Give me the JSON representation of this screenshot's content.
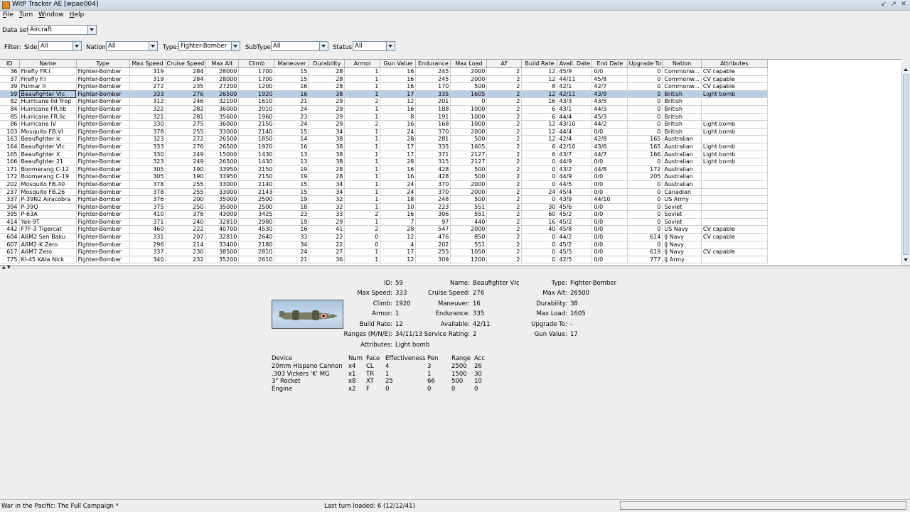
{
  "window": {
    "title": "WitP Tracker AE [wpae004]"
  },
  "menu": [
    {
      "first": "F",
      "rest": "ile"
    },
    {
      "first": "T",
      "rest": "urn"
    },
    {
      "first": "W",
      "rest": "indow"
    },
    {
      "first": "H",
      "rest": "elp"
    }
  ],
  "dataset": {
    "label": "Data set:",
    "value": "Aircraft"
  },
  "filter": {
    "label": "Filter:",
    "side": {
      "label": "Side:",
      "value": "All"
    },
    "nation": {
      "label": "Nation:",
      "value": "All"
    },
    "type": {
      "label": "Type:",
      "value": "Fighter-Bomber"
    },
    "subtype": {
      "label": "SubType:",
      "value": "All"
    },
    "status": {
      "label": "Status:",
      "value": "All"
    }
  },
  "table": {
    "columns": [
      "ID",
      "Name",
      "Type",
      "Max Speed",
      "Cruise Speed",
      "Max Alt",
      "Climb",
      "Maneuver",
      "Durability",
      "Armor",
      "Gun Value",
      "Endurance",
      "Max Load",
      "AF",
      "Build Rate",
      "Avail. Date",
      "End Date",
      "Upgrade To",
      "Nation",
      "Attributes"
    ],
    "selected_index": 3,
    "rows": [
      [
        "36",
        "Firefly FR.I",
        "Fighter-Bomber",
        "319",
        "284",
        "28000",
        "1700",
        "15",
        "28",
        "1",
        "16",
        "245",
        "2000",
        "2",
        "12",
        "45/9",
        "0/0",
        "0",
        "Commonw...",
        "CV capable"
      ],
      [
        "37",
        "Firefly F.I",
        "Fighter-Bomber",
        "319",
        "284",
        "28000",
        "1700",
        "15",
        "28",
        "1",
        "16",
        "245",
        "2000",
        "2",
        "12",
        "44/11",
        "45/8",
        "0",
        "Commonw...",
        "CV capable"
      ],
      [
        "39",
        "Fulmar II",
        "Fighter-Bomber",
        "272",
        "235",
        "27200",
        "1200",
        "16",
        "28",
        "1",
        "16",
        "170",
        "500",
        "2",
        "8",
        "42/1",
        "42/7",
        "0",
        "Commonw...",
        "CV capable"
      ],
      [
        "59",
        "Beaufighter VIc",
        "Fighter-Bomber",
        "333",
        "276",
        "26500",
        "1920",
        "16",
        "38",
        "1",
        "17",
        "335",
        "1605",
        "2",
        "12",
        "42/11",
        "43/9",
        "0",
        "British",
        "Light bomb"
      ],
      [
        "82",
        "Hurricane IId Trop",
        "Fighter-Bomber",
        "312",
        "246",
        "32100",
        "1610",
        "21",
        "29",
        "2",
        "12",
        "201",
        "0",
        "2",
        "16",
        "43/3",
        "43/5",
        "0",
        "British",
        ""
      ],
      [
        "84",
        "Hurricane FR.IIb",
        "Fighter-Bomber",
        "322",
        "282",
        "36000",
        "2010",
        "24",
        "29",
        "1",
        "16",
        "188",
        "1000",
        "2",
        "6",
        "43/1",
        "44/3",
        "0",
        "British",
        ""
      ],
      [
        "85",
        "Hurricane FR.IIc",
        "Fighter-Bomber",
        "321",
        "281",
        "35600",
        "1960",
        "23",
        "29",
        "1",
        "8",
        "191",
        "1000",
        "2",
        "6",
        "44/4",
        "45/3",
        "0",
        "British",
        ""
      ],
      [
        "86",
        "Hurricane IV",
        "Fighter-Bomber",
        "330",
        "275",
        "36000",
        "2150",
        "24",
        "29",
        "2",
        "16",
        "168",
        "1000",
        "2",
        "12",
        "43/10",
        "44/2",
        "0",
        "British",
        "Light bomb"
      ],
      [
        "103",
        "Mosquito FB.VI",
        "Fighter-Bomber",
        "378",
        "255",
        "33000",
        "2140",
        "15",
        "34",
        "1",
        "24",
        "370",
        "2000",
        "2",
        "12",
        "44/4",
        "0/0",
        "0",
        "British",
        "Light bomb"
      ],
      [
        "163",
        "Beaufighter Ic",
        "Fighter-Bomber",
        "323",
        "272",
        "26500",
        "1850",
        "14",
        "38",
        "1",
        "28",
        "281",
        "500",
        "2",
        "12",
        "42/4",
        "42/8",
        "165",
        "Australian",
        ""
      ],
      [
        "164",
        "Beaufighter VIc",
        "Fighter-Bomber",
        "333",
        "276",
        "26500",
        "1920",
        "16",
        "38",
        "1",
        "17",
        "335",
        "1605",
        "2",
        "6",
        "42/10",
        "43/6",
        "165",
        "Australian",
        "Light bomb"
      ],
      [
        "165",
        "Beaufighter X",
        "Fighter-Bomber",
        "330",
        "249",
        "15000",
        "1430",
        "13",
        "38",
        "1",
        "17",
        "371",
        "2127",
        "2",
        "6",
        "43/7",
        "44/7",
        "166",
        "Australian",
        "Light bomb"
      ],
      [
        "166",
        "Beaufighter 21",
        "Fighter-Bomber",
        "323",
        "249",
        "26500",
        "1430",
        "13",
        "38",
        "1",
        "28",
        "315",
        "2127",
        "2",
        "0",
        "44/9",
        "0/0",
        "0",
        "Australian",
        "Light bomb"
      ],
      [
        "171",
        "Boomerang C-12",
        "Fighter-Bomber",
        "305",
        "190",
        "33950",
        "2150",
        "19",
        "28",
        "1",
        "16",
        "428",
        "500",
        "2",
        "0",
        "43/2",
        "44/8",
        "172",
        "Australian",
        ""
      ],
      [
        "172",
        "Boomerang C-19",
        "Fighter-Bomber",
        "305",
        "190",
        "33950",
        "2150",
        "19",
        "28",
        "1",
        "16",
        "428",
        "500",
        "2",
        "0",
        "44/9",
        "0/0",
        "205",
        "Australian",
        ""
      ],
      [
        "202",
        "Mosquito FB.40",
        "Fighter-Bomber",
        "378",
        "255",
        "33000",
        "2140",
        "15",
        "34",
        "1",
        "24",
        "370",
        "2000",
        "2",
        "0",
        "44/5",
        "0/0",
        "0",
        "Australian",
        ""
      ],
      [
        "237",
        "Mosquito FB.26",
        "Fighter-Bomber",
        "378",
        "255",
        "33000",
        "2143",
        "15",
        "34",
        "1",
        "24",
        "370",
        "2000",
        "2",
        "24",
        "45/4",
        "0/0",
        "0",
        "Canadian",
        ""
      ],
      [
        "337",
        "P-39N2 Airacobra",
        "Fighter-Bomber",
        "376",
        "200",
        "35000",
        "2500",
        "19",
        "32",
        "1",
        "18",
        "248",
        "500",
        "2",
        "0",
        "43/9",
        "44/10",
        "0",
        "US Army",
        ""
      ],
      [
        "394",
        "P-39Q",
        "Fighter-Bomber",
        "375",
        "250",
        "35000",
        "2500",
        "18",
        "32",
        "1",
        "10",
        "223",
        "551",
        "2",
        "30",
        "45/6",
        "0/0",
        "0",
        "Soviet",
        ""
      ],
      [
        "395",
        "P-63A",
        "Fighter-Bomber",
        "410",
        "378",
        "43000",
        "3425",
        "23",
        "33",
        "2",
        "16",
        "306",
        "551",
        "2",
        "60",
        "45/2",
        "0/0",
        "0",
        "Soviet",
        ""
      ],
      [
        "414",
        "Yak-9T",
        "Fighter-Bomber",
        "371",
        "240",
        "32810",
        "2980",
        "19",
        "29",
        "1",
        "7",
        "97",
        "440",
        "2",
        "16",
        "45/2",
        "0/0",
        "0",
        "Soviet",
        ""
      ],
      [
        "442",
        "F7F-3 Tigercat",
        "Fighter-Bomber",
        "460",
        "222",
        "40700",
        "4530",
        "16",
        "41",
        "2",
        "28",
        "547",
        "2000",
        "2",
        "40",
        "45/8",
        "0/0",
        "0",
        "US Navy",
        "CV capable"
      ],
      [
        "604",
        "A6M2 Sen Baku",
        "Fighter-Bomber",
        "331",
        "207",
        "32810",
        "2640",
        "33",
        "22",
        "0",
        "12",
        "476",
        "850",
        "2",
        "0",
        "44/2",
        "0/0",
        "614",
        "IJ Navy",
        "CV capable"
      ],
      [
        "607",
        "A6M2-K Zero",
        "Fighter-Bomber",
        "296",
        "214",
        "33400",
        "2180",
        "34",
        "22",
        "0",
        "4",
        "202",
        "551",
        "2",
        "0",
        "45/2",
        "0/0",
        "0",
        "IJ Navy",
        ""
      ],
      [
        "617",
        "A6M7 Zero",
        "Fighter-Bomber",
        "337",
        "230",
        "38500",
        "2810",
        "24",
        "27",
        "1",
        "17",
        "255",
        "1050",
        "2",
        "0",
        "45/5",
        "0/0",
        "619",
        "IJ Navy",
        "CV capable"
      ],
      [
        "775",
        "Ki-45 KAIa Nick",
        "Fighter-Bomber",
        "340",
        "232",
        "35200",
        "2610",
        "21",
        "36",
        "1",
        "12",
        "309",
        "1200",
        "2",
        "0",
        "42/5",
        "0/0",
        "777",
        "IJ Army",
        ""
      ]
    ]
  },
  "detail": {
    "fields": [
      {
        "label": "ID:",
        "value": "59"
      },
      {
        "label": "Name:",
        "value": "Beaufighter VIc"
      },
      {
        "label": "Type:",
        "value": "Fighter-Bomber"
      },
      {
        "label": "Max Speed:",
        "value": "333"
      },
      {
        "label": "Cruise Speed:",
        "value": "276"
      },
      {
        "label": "Max Alt:",
        "value": "26500"
      },
      {
        "label": "Climb:",
        "value": "1920"
      },
      {
        "label": "Maneuver:",
        "value": "16"
      },
      {
        "label": "Durability:",
        "value": "38"
      },
      {
        "label": "Armor:",
        "value": "1"
      },
      {
        "label": "Endurance:",
        "value": "335"
      },
      {
        "label": "Max Load:",
        "value": "1605"
      },
      {
        "label": "Build Rate:",
        "value": "12"
      },
      {
        "label": "Available:",
        "value": "42/11"
      },
      {
        "label": "Upgrade To:",
        "value": "-"
      },
      {
        "label": "Ranges (M/N/E):",
        "value": "34/11/13"
      },
      {
        "label": "Service Rating:",
        "value": "2"
      },
      {
        "label": "Gun Value:",
        "value": "17"
      },
      {
        "label": "Attributes:",
        "value": "Light bomb"
      }
    ],
    "devices": {
      "headers": [
        "Device",
        "Num",
        "Face",
        "Effectiveness",
        "Pen",
        "Range",
        "Acc"
      ],
      "rows": [
        [
          "20mm Hispano Cannon",
          "x4",
          "CL",
          "4",
          "3",
          "2500",
          "26"
        ],
        [
          ".303 Vickers 'K' MG",
          "x1",
          "TR",
          "1",
          "1",
          "1500",
          "30"
        ],
        [
          "3\" Rocket",
          "x8",
          "XT",
          "25",
          "66",
          "500",
          "10"
        ],
        [
          "Engine",
          "x2",
          "F",
          "0",
          "0",
          "0",
          "0"
        ]
      ]
    }
  },
  "statusbar": {
    "left": "War in the Pacific: The Full Campaign  *",
    "middle": "Last turn loaded: 6 (12/12/41)"
  }
}
